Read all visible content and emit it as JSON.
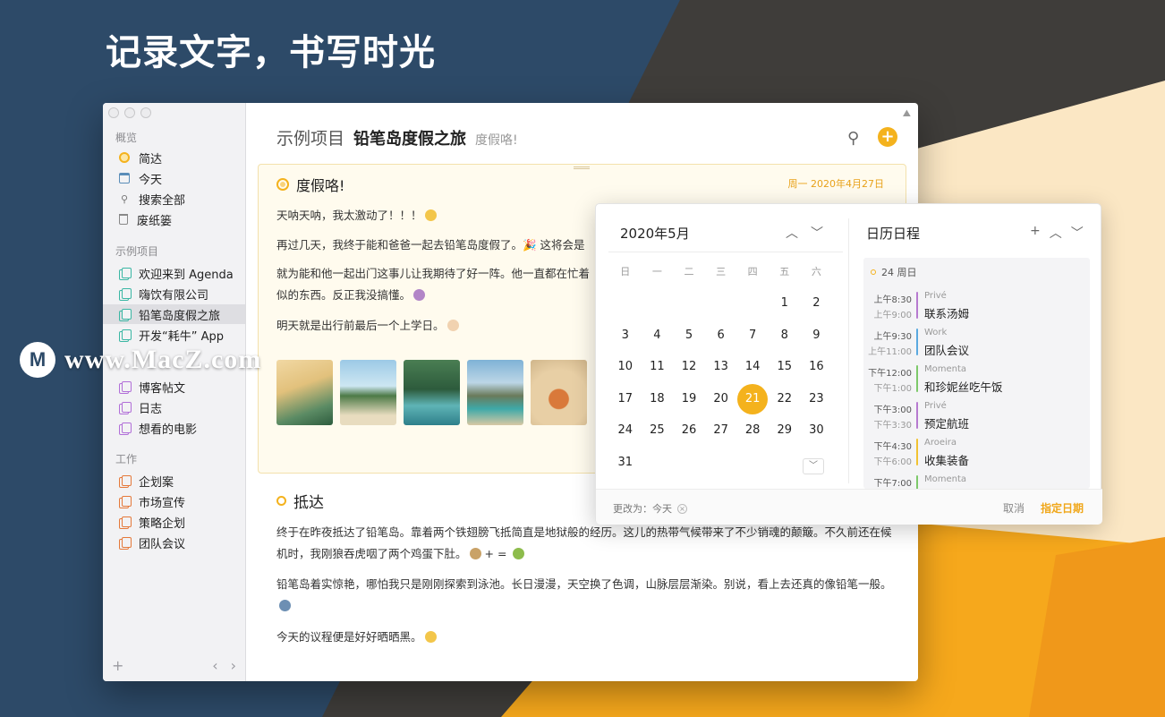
{
  "hero": {
    "title": "记录文字，书写时光"
  },
  "watermark": {
    "text": "www.MacZ.com"
  },
  "sidebar": {
    "overview_label": "概览",
    "overview": [
      {
        "label": "简达",
        "icon": "agenda-dot-icon"
      },
      {
        "label": "今天",
        "icon": "calendar-icon"
      },
      {
        "label": "搜索全部",
        "icon": "search-icon"
      },
      {
        "label": "废纸篓",
        "icon": "trash-icon"
      }
    ],
    "projects_label": "示例项目",
    "projects": [
      {
        "label": "欢迎来到 Agenda"
      },
      {
        "label": "嗨饮有限公司"
      },
      {
        "label": "铅笔岛度假之旅"
      },
      {
        "label": "开发“耗牛” App"
      }
    ],
    "personal": [
      {
        "label": "博客帖文"
      },
      {
        "label": "日志"
      },
      {
        "label": "想看的电影"
      }
    ],
    "work_label": "工作",
    "work": [
      {
        "label": "企划案"
      },
      {
        "label": "市场宣传"
      },
      {
        "label": "策略企划"
      },
      {
        "label": "团队会议"
      }
    ],
    "add_label": "+",
    "prev_label": "‹",
    "next_label": "›"
  },
  "header": {
    "project": "示例项目",
    "title": "铅笔岛度假之旅",
    "subtitle": "度假咯!",
    "search_icon": "search-icon",
    "add_label": "+",
    "accent": "#f4b21d"
  },
  "note1": {
    "title": "度假咯!",
    "date": "周一 2020年4月27日",
    "p1": "天呐天呐，我太激动了！！！",
    "p2": "再过几天，我终于能和爸爸一起去铅笔岛度假了。🎉 这将会是",
    "p3a": "就为能和他一起出门这事儿让我期待了好一阵。他一直都在忙着",
    "p3b": "似的东西。反正我没搞懂。",
    "p4": "明天就是出行前最后一个上学日。"
  },
  "note2": {
    "title": "抵达",
    "p1": "终于在昨夜抵达了铅笔岛。靠着两个铁翅膀飞抵简直是地狱般的经历。这儿的热带气候带来了不少销魂的颠簸。不久前还在候机时，我刚狼吞虎咽了两个鸡蛋下肚。",
    "p1_eq": "+ = ",
    "p2": "铅笔岛着实惊艳，哪怕我只是刚刚探索到泳池。长日漫漫，天空换了色调，山脉层层渐染。别说，看上去还真的像铅笔一般。",
    "p3": "今天的议程便是好好晒晒黑。"
  },
  "calendar": {
    "title": "2020年5月",
    "prev": "︿",
    "next": "﹀",
    "weekdays": [
      "日",
      "一",
      "二",
      "三",
      "四",
      "五",
      "六"
    ],
    "weeks": [
      [
        "",
        "",
        "",
        "",
        "",
        "1",
        "2"
      ],
      [
        "3",
        "4",
        "5",
        "6",
        "7",
        "8",
        "9"
      ],
      [
        "10",
        "11",
        "12",
        "13",
        "14",
        "15",
        "16"
      ],
      [
        "17",
        "18",
        "19",
        "20",
        "21",
        "22",
        "23"
      ],
      [
        "24",
        "25",
        "26",
        "27",
        "28",
        "29",
        "30"
      ],
      [
        "31",
        "",
        "",
        "",
        "",
        "",
        ""
      ]
    ],
    "selected": "21",
    "more": "﹀"
  },
  "agenda": {
    "title": "日历日程",
    "add": "+",
    "prev": "︿",
    "next": "﹀",
    "day_label": "24 周日",
    "events": [
      {
        "start": "上午8:30",
        "end": "上午9:00",
        "calendar": "Privé",
        "title": "联系汤姆",
        "color": "#b77ad0"
      },
      {
        "start": "上午9:30",
        "end": "上午11:00",
        "calendar": "Work",
        "title": "团队会议",
        "color": "#5aa9e0"
      },
      {
        "start": "下午12:00",
        "end": "下午1:00",
        "calendar": "Momenta",
        "title": "和珍妮丝吃午饭",
        "color": "#7dc96a"
      },
      {
        "start": "下午3:00",
        "end": "下午3:30",
        "calendar": "Privé",
        "title": "预定航班",
        "color": "#b77ad0"
      },
      {
        "start": "下午4:30",
        "end": "下午6:00",
        "calendar": "Aroeira",
        "title": "收集装备",
        "color": "#f1c232"
      },
      {
        "start": "下午7:00",
        "end": "",
        "calendar": "Momenta",
        "title": "",
        "color": "#7dc96a"
      }
    ]
  },
  "footer": {
    "change_label": "更改为：今天",
    "clear": "×",
    "cancel": "取消",
    "assign": "指定日期"
  }
}
